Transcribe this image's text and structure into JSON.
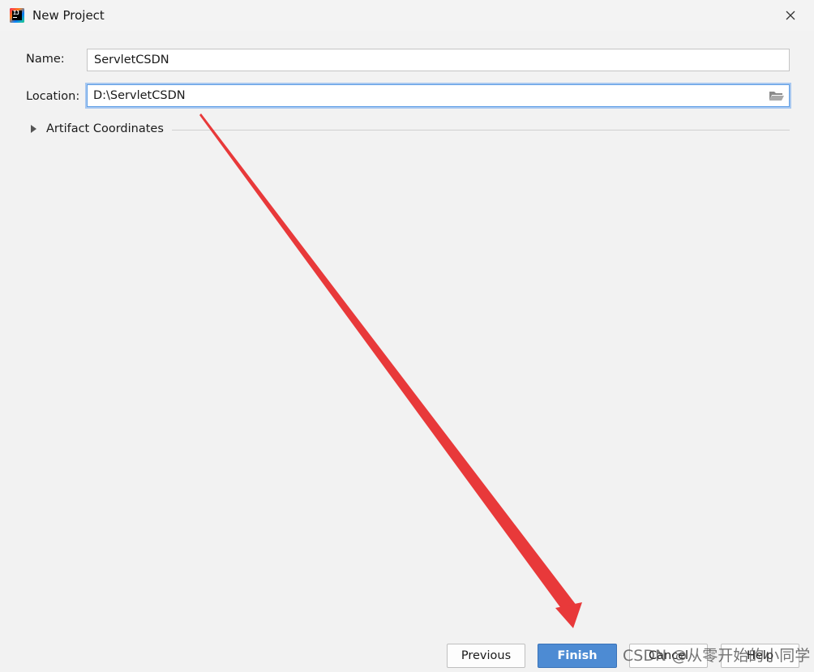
{
  "window": {
    "title": "New Project",
    "app_icon": "intellij-idea-icon",
    "close_icon": "close-icon"
  },
  "form": {
    "name_label": "Name:",
    "name_value": "ServletCSDN",
    "location_label": "Location:",
    "location_value": "D:\\ServletCSDN",
    "browse_icon": "folder-icon",
    "artifact_label": "Artifact Coordinates",
    "artifact_expanded": false
  },
  "buttons": {
    "previous": "Previous",
    "finish": "Finish",
    "cancel": "Cancel",
    "help": "Help"
  },
  "annotation": {
    "arrow_color": "#e8393a"
  },
  "watermark": {
    "text": "CSDN @从零开始的小同学"
  },
  "colors": {
    "background": "#f2f2f2",
    "finish_button": "#4d8bd3",
    "focus_border": "#5e9ee6"
  }
}
